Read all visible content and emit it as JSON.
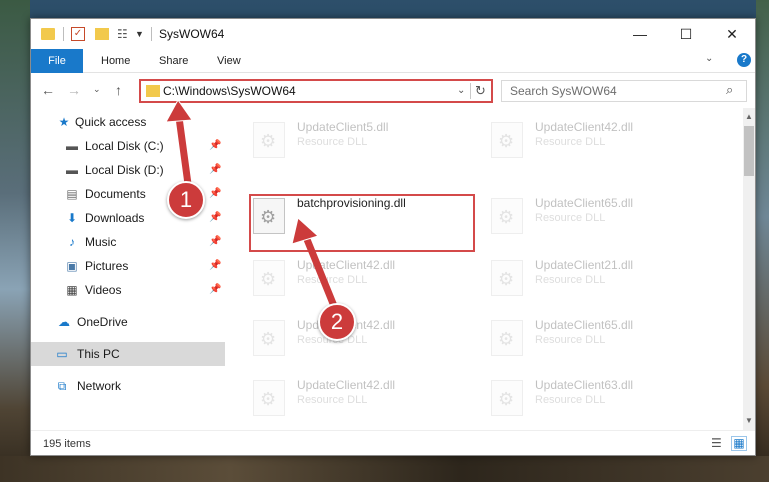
{
  "window": {
    "title": "SysWOW64",
    "controls": {
      "minimize": "—",
      "maximize": "☐",
      "close": "✕"
    }
  },
  "ribbon": {
    "tabs": [
      "File",
      "Home",
      "Share",
      "View"
    ],
    "help": "?"
  },
  "navigation": {
    "back": "←",
    "forward": "→",
    "recent": "⌄",
    "up": "↑"
  },
  "address": {
    "path": "C:\\Windows\\SysWOW64",
    "dropdown": "⌄",
    "refresh": "↻"
  },
  "search": {
    "placeholder": "Search SysWOW64",
    "icon": "⌕"
  },
  "nav_pane": [
    {
      "label": "Quick access",
      "icon": "star-icon",
      "glyph": "★",
      "color": "#1979ca",
      "pinned": false
    },
    {
      "label": "Local Disk (C:)",
      "icon": "drive-icon",
      "glyph": "▬",
      "color": "#555555",
      "pinned": true
    },
    {
      "label": "Local Disk (D:)",
      "icon": "drive-icon",
      "glyph": "▬",
      "color": "#555555",
      "pinned": true
    },
    {
      "label": "Documents",
      "icon": "documents-icon",
      "glyph": "▤",
      "color": "#6d6d6d",
      "pinned": true
    },
    {
      "label": "Downloads",
      "icon": "download-icon",
      "glyph": "⬇",
      "color": "#1979ca",
      "pinned": true
    },
    {
      "label": "Music",
      "icon": "music-icon",
      "glyph": "♪",
      "color": "#1979ca",
      "pinned": true
    },
    {
      "label": "Pictures",
      "icon": "pictures-icon",
      "glyph": "▣",
      "color": "#4a7aa8",
      "pinned": true
    },
    {
      "label": "Videos",
      "icon": "videos-icon",
      "glyph": "▦",
      "color": "#444444",
      "pinned": true
    },
    {
      "label": "OneDrive",
      "icon": "cloud-icon",
      "glyph": "☁",
      "color": "#1979ca",
      "pinned": false
    },
    {
      "label": "This PC",
      "icon": "computer-icon",
      "glyph": "▭",
      "color": "#1979ca",
      "pinned": false,
      "selected": true
    },
    {
      "label": "Network",
      "icon": "network-icon",
      "glyph": "⧉",
      "color": "#1979ca",
      "pinned": false
    }
  ],
  "pin_glyph": "📌",
  "files": [
    {
      "name": "UpdateClient5.dll",
      "type": "Resource DLL",
      "faded": true
    },
    {
      "name": "UpdateClient42.dll",
      "type": "Resource DLL",
      "faded": true
    },
    {
      "name": "batchprovisioning.dll",
      "type": "",
      "faded": false,
      "highlighted": true
    },
    {
      "name": "UpdateClient65.dll",
      "type": "Resource DLL",
      "faded": true
    },
    {
      "name": "UpdateClient42.dll",
      "type": "Resource DLL",
      "faded": true
    },
    {
      "name": "UpdateClient21.dll",
      "type": "Resource DLL",
      "faded": true
    },
    {
      "name": "UpdateClient42.dll",
      "type": "Resource DLL",
      "faded": true
    },
    {
      "name": "UpdateClient65.dll",
      "type": "Resource DLL",
      "faded": true
    },
    {
      "name": "UpdateClient42.dll",
      "type": "Resource DLL",
      "faded": true
    },
    {
      "name": "UpdateClient63.dll",
      "type": "Resource DLL",
      "faded": true
    }
  ],
  "status": {
    "item_count": "195 items"
  },
  "callouts": [
    "1",
    "2"
  ],
  "colors": {
    "accent": "#1979ca",
    "highlight": "#d44a4a",
    "callout": "#cc3b3b"
  }
}
